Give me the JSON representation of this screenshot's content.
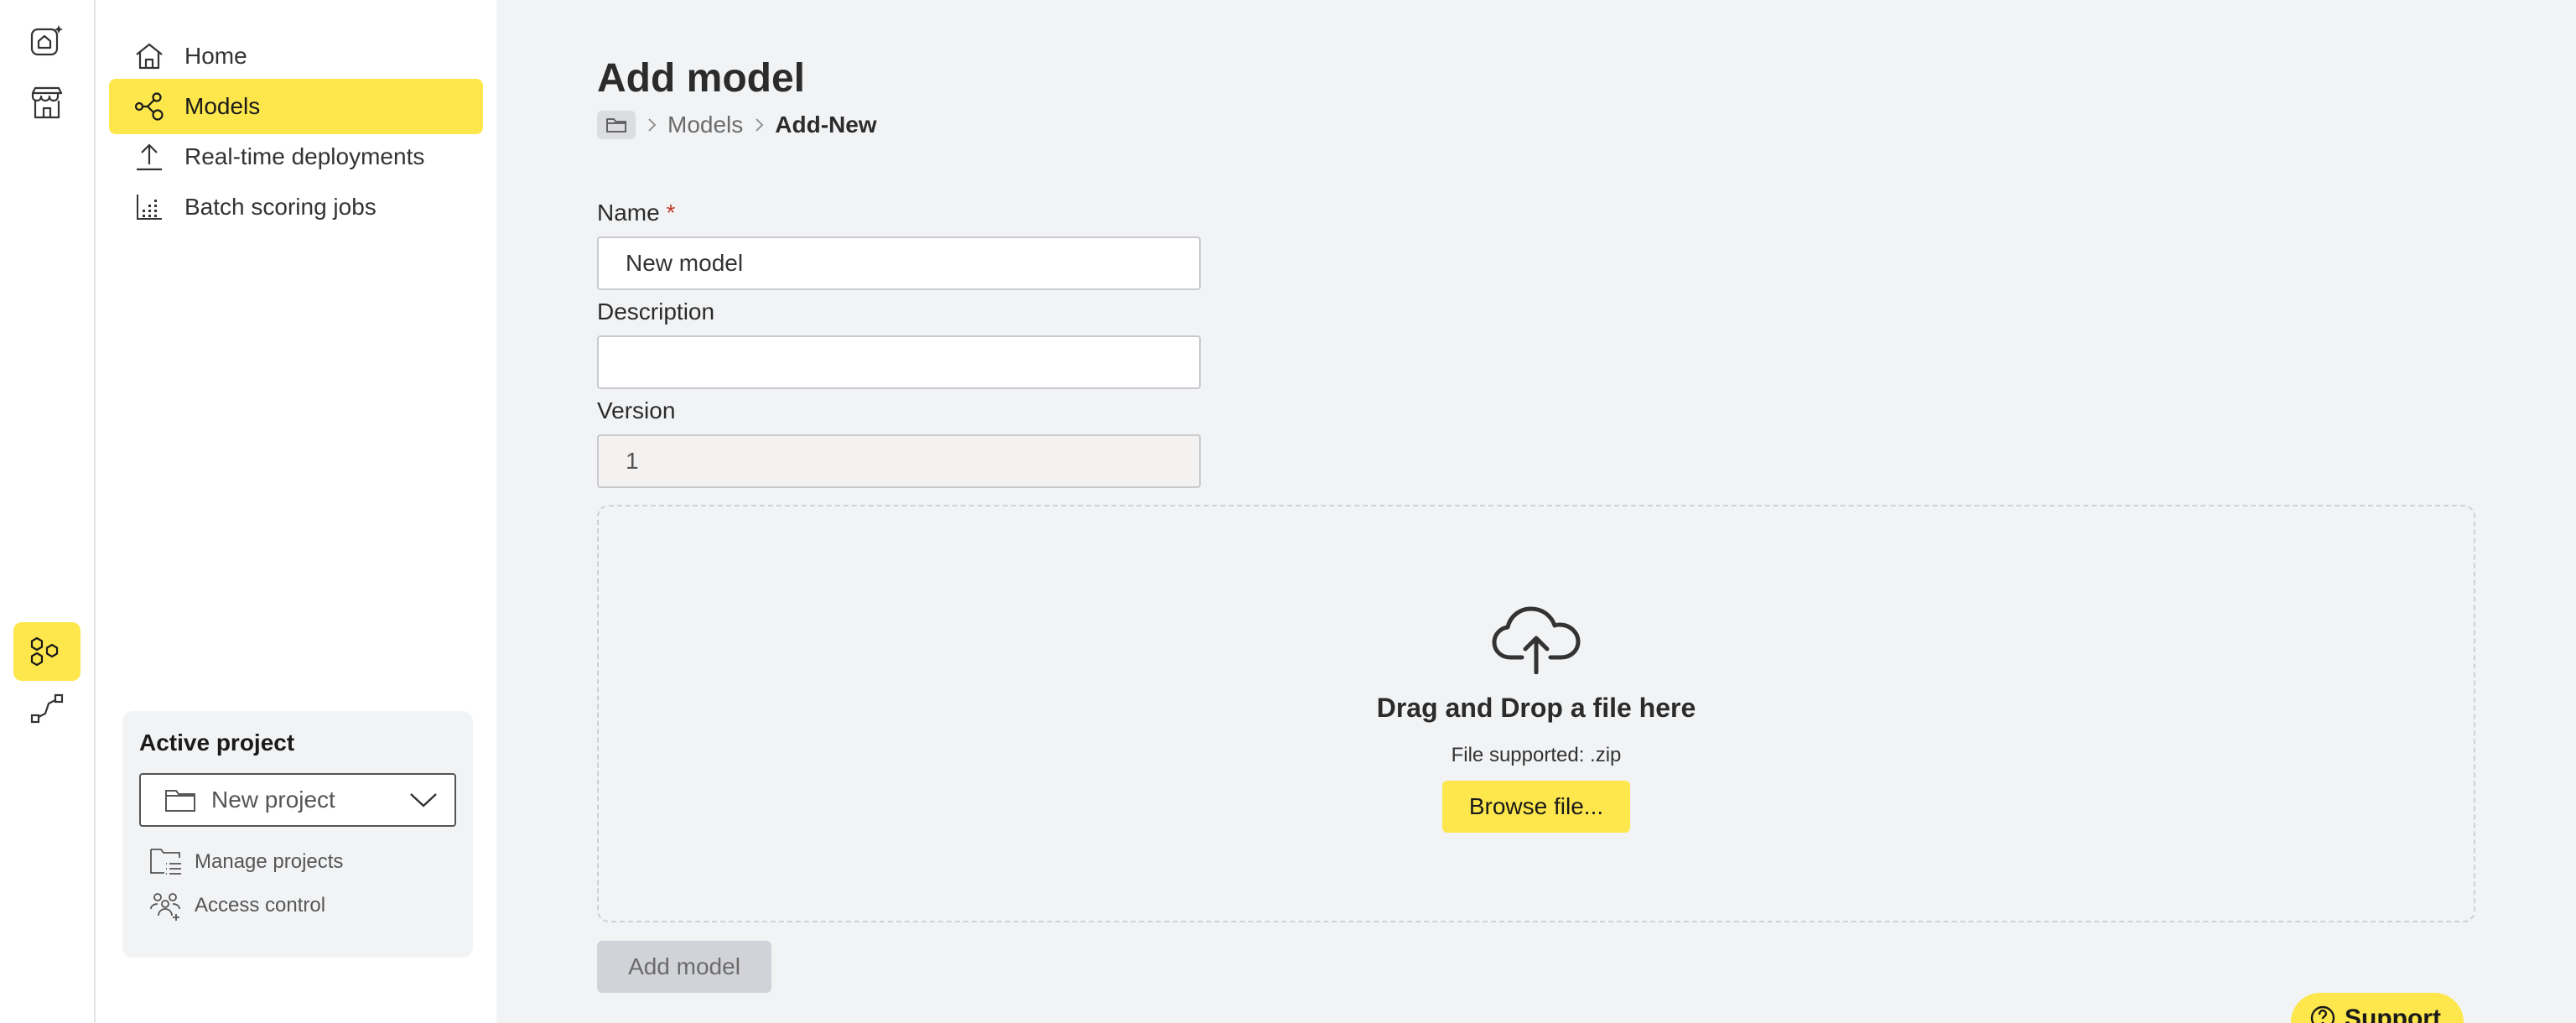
{
  "rail": {
    "items": [
      {
        "icon": "home-sparkle-icon"
      },
      {
        "icon": "storefront-icon"
      },
      {
        "icon": "hexagons-icon",
        "active": true
      },
      {
        "icon": "pipeline-icon"
      }
    ]
  },
  "sidebar": {
    "items": [
      {
        "label": "Home",
        "icon": "home-icon"
      },
      {
        "label": "Models",
        "icon": "models-icon",
        "active": true
      },
      {
        "label": "Real-time deployments",
        "icon": "upload-icon"
      },
      {
        "label": "Batch scoring jobs",
        "icon": "batch-chart-icon"
      }
    ],
    "project": {
      "title": "Active project",
      "selected": "New project",
      "links": [
        "Manage projects",
        "Access control"
      ]
    }
  },
  "main": {
    "title": "Add model",
    "breadcrumb": {
      "parent": "Models",
      "current": "Add-New"
    },
    "form": {
      "name_label": "Name",
      "required_mark": "*",
      "name_value": "New model",
      "description_label": "Description",
      "description_value": "",
      "version_label": "Version",
      "version_value": "1"
    },
    "dropzone": {
      "title": "Drag and Drop a file here",
      "subtitle": "File supported: .zip",
      "browse_label": "Browse file..."
    },
    "submit_label": "Add model",
    "support_label": "Support"
  },
  "colors": {
    "accent": "#fde74c",
    "background": "#f2f3f5",
    "required": "#c0392b"
  }
}
